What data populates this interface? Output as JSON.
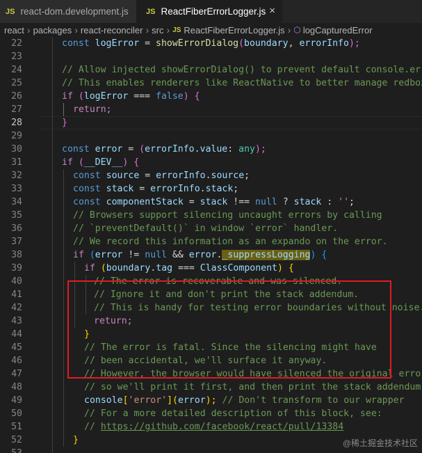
{
  "tabs": [
    {
      "icon": "JS",
      "label": "react-dom.development.js"
    },
    {
      "icon": "JS",
      "label": "ReactFiberErrorLogger.js",
      "close": "×"
    }
  ],
  "breadcrumb": {
    "items": [
      "react",
      "packages",
      "react-reconciler",
      "src"
    ],
    "file_icon": "JS",
    "file": "ReactFiberErrorLogger.js",
    "symbol": "logCapturedError",
    "separator": "›"
  },
  "gutter": [
    "22",
    "23",
    "24",
    "25",
    "26",
    "27",
    "28",
    "29",
    "30",
    "31",
    "32",
    "33",
    "34",
    "35",
    "36",
    "37",
    "38",
    "39",
    "40",
    "41",
    "42",
    "43",
    "44",
    "45",
    "46",
    "47",
    "48",
    "49",
    "50",
    "51",
    "52",
    "53"
  ],
  "code": {
    "l22": {
      "a": "const ",
      "b": "logError",
      "c": " = ",
      "d": "showErrorDialog",
      "e": "(",
      "f": "boundary",
      "g": ", ",
      "h": "errorInfo",
      "i": ");"
    },
    "l24": "// Allow injected showErrorDialog() to prevent default console.error",
    "l25": "// This enables renderers like ReactNative to better manage redbox",
    "l26": {
      "a": "if ",
      "b": "(",
      "c": "logError",
      "d": " === ",
      "e": "false",
      "f": ") ",
      "g": "{"
    },
    "l27": "return;",
    "l28": "}",
    "l30": {
      "a": "const ",
      "b": "error",
      "c": " = ",
      "d": "(",
      "e": "errorInfo",
      "f": ".",
      "g": "value",
      "h": ": ",
      "i": "any",
      "j": ");"
    },
    "l31": {
      "a": "if ",
      "b": "(",
      "c": "__DEV__",
      "d": ") ",
      "e": "{"
    },
    "l32": {
      "a": "const ",
      "b": "source",
      "c": " = ",
      "d": "errorInfo",
      "e": ".",
      "f": "source",
      "g": ";"
    },
    "l33": {
      "a": "const ",
      "b": "stack",
      "c": " = ",
      "d": "errorInfo",
      "e": ".",
      "f": "stack",
      "g": ";"
    },
    "l34": {
      "a": "const ",
      "b": "componentStack",
      "c": " = ",
      "d": "stack",
      "e": " !== ",
      "f": "null",
      "g": " ? ",
      "h": "stack",
      "i": " : ",
      "j": "''",
      "k": ";"
    },
    "l35": "// Browsers support silencing uncaught errors by calling",
    "l36": "// `preventDefault()` in window `error` handler.",
    "l37": "// We record this information as an expando on the error.",
    "l38": {
      "a": "if ",
      "b": "(",
      "c": "error",
      "d": " != ",
      "e": "null",
      "f": " && ",
      "g": "error",
      "h": ".",
      "i": "_suppressLogging",
      "j": ") ",
      "k": "{"
    },
    "l39": {
      "a": "if ",
      "b": "(",
      "c": "boundary",
      "d": ".",
      "e": "tag",
      "f": " === ",
      "g": "ClassComponent",
      "h": ") ",
      "i": "{"
    },
    "l40": "// The error is recoverable and was silenced.",
    "l41": "// Ignore it and don't print the stack addendum.",
    "l42": "// This is handy for testing error boundaries without noise.",
    "l43": "return;",
    "l44": "}",
    "l45": "// The error is fatal. Since the silencing might have",
    "l46": "// been accidental, we'll surface it anyway.",
    "l47": "// However, the browser would have silenced the original error",
    "l48": "// so we'll print it first, and then print the stack addendum.",
    "l49": {
      "a": "console",
      "b": "[",
      "c": "'error'",
      "d": "](",
      "e": "error",
      "f": "); ",
      "g": "// Don't transform to our wrapper"
    },
    "l50": "// For a more detailed description of this block, see:",
    "l51": {
      "a": "// ",
      "b": "https://github.com/facebook/react/pull/13384"
    },
    "l52": "}"
  },
  "watermark": "@稀土掘金技术社区",
  "colors": {
    "keyword": "#569cd6",
    "control": "#c586c0",
    "variable": "#9cdcfe",
    "function": "#dcdcaa",
    "type": "#4ec9b0",
    "string": "#ce9178",
    "comment": "#6a9955",
    "annotation_box": "#e31b23",
    "highlight": "#6b5f12"
  }
}
